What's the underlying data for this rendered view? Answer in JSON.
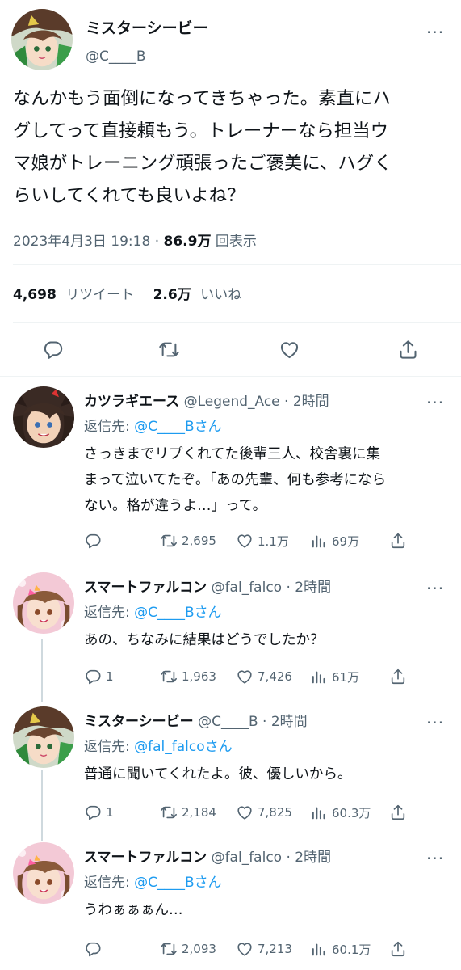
{
  "main_tweet": {
    "name": "ミスターシービー",
    "handle": "@C____B",
    "text_lines": [
      "なんかもう面倒になってきちゃった。素直にハ",
      "グしてって直接頼もう。トレーナーなら担当ウ",
      "マ娘がトレーニング頑張ったご褒美に、ハグく",
      "らいしてくれても良いよね？"
    ],
    "timestamp": "2023年4月3日 19:18 · ",
    "views_count": "86.9万",
    "views_label": " 回表示",
    "retweets_count": "4,698",
    "retweets_label": "リツイート",
    "likes_count": "2.6万",
    "likes_label": "いいね"
  },
  "replies": [
    {
      "name": "カツラギエース",
      "meta": "@Legend_Ace · 2時間",
      "reply_prefix": "返信先: ",
      "reply_to": "@C____Bさん",
      "text_lines": [
        "さっきまでリプくれてた後輩三人、校舎裏に集",
        "まって泣いてたぞ。「あの先輩、何も参考になら",
        "ない。格が違うよ…」って。"
      ],
      "reply_count": "",
      "retweet_count": "2,695",
      "like_count": "1.1万",
      "view_count": "69万"
    },
    {
      "name": "スマートファルコン",
      "meta": "@fal_falco · 2時間",
      "reply_prefix": "返信先: ",
      "reply_to": "@C____Bさん",
      "text_lines": [
        "あの、ちなみに結果はどうでしたか？"
      ],
      "reply_count": "1",
      "retweet_count": "1,963",
      "like_count": "7,426",
      "view_count": "61万"
    },
    {
      "name": "ミスターシービー",
      "meta": "@C____B · 2時間",
      "reply_prefix": "返信先: ",
      "reply_to": "@fal_falcoさん",
      "text_lines": [
        "普通に聞いてくれたよ。彼、優しいから。"
      ],
      "reply_count": "1",
      "retweet_count": "2,184",
      "like_count": "7,825",
      "view_count": "60.3万"
    },
    {
      "name": "スマートファルコン",
      "meta": "@fal_falco · 2時間",
      "reply_prefix": "返信先: ",
      "reply_to": "@C____Bさん",
      "text_lines": [
        "うわぁぁぁん…"
      ],
      "reply_count": "",
      "retweet_count": "2,093",
      "like_count": "7,213",
      "view_count": "60.1万"
    }
  ],
  "more_glyph": "···",
  "icons": [
    "reply-icon",
    "retweet-icon",
    "like-icon",
    "share-icon",
    "views-icon",
    "more-icon"
  ],
  "colors": {
    "accent": "#1d9bf0",
    "text": "#0f1419",
    "secondary": "#536471",
    "border": "#eff3f4"
  }
}
